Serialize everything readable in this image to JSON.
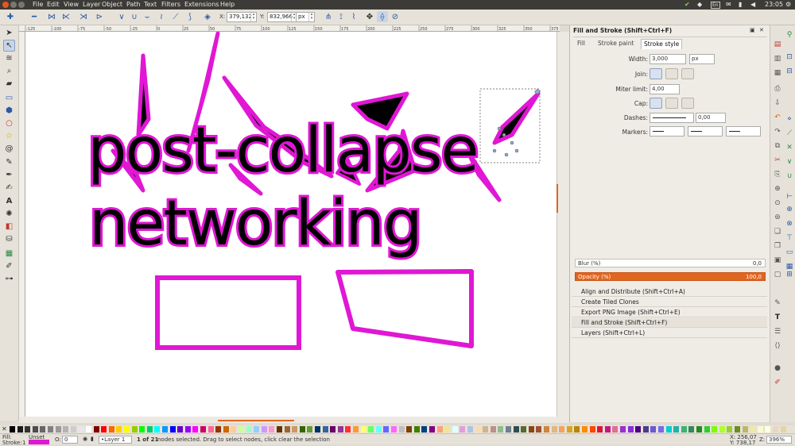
{
  "menubar": {
    "items": [
      "File",
      "Edit",
      "View",
      "Layer",
      "Object",
      "Path",
      "Text",
      "Filters",
      "Extensions",
      "Help"
    ],
    "tray": {
      "lang": "En",
      "clock": "23:05"
    }
  },
  "toolcontrols": {
    "x_label": "X:",
    "x_value": "379,132",
    "y_label": "Y:",
    "y_value": "832,966",
    "unit": "px"
  },
  "ruler": {
    "ticks": [
      "-125",
      "-100",
      "-75",
      "-50",
      "-25",
      "0",
      "25",
      "50",
      "75",
      "100",
      "125",
      "150",
      "175",
      "200",
      "225",
      "250",
      "275",
      "300",
      "325",
      "350",
      "375"
    ]
  },
  "canvas": {
    "line1": "post-collapse",
    "line2": "networking",
    "colors": {
      "magenta": "#e017d4",
      "black": "#000000"
    }
  },
  "dock": {
    "title": "Fill and Stroke (Shift+Ctrl+F)",
    "tabs": [
      "Fill",
      "Stroke paint",
      "Stroke style"
    ],
    "width_label": "Width:",
    "width_value": "3,000",
    "width_unit": "px",
    "join_label": "Join:",
    "miter_label": "Miter limit:",
    "miter_value": "4,00",
    "cap_label": "Cap:",
    "dashes_label": "Dashes:",
    "dashes_value": "0,00",
    "markers_label": "Markers:",
    "blur_label": "Blur (%)",
    "blur_value": "0,0",
    "opacity_label": "Opacity (%)",
    "opacity_value": "100,0",
    "sections": [
      "Align and Distribute (Shift+Ctrl+A)",
      "Create Tiled Clones",
      "Export PNG Image (Shift+Ctrl+E)",
      "Fill and Stroke (Shift+Ctrl+F)",
      "Layers (Shift+Ctrl+L)"
    ]
  },
  "status": {
    "fill_label": "Fill:",
    "stroke_label": "Stroke:",
    "stroke_value": "1",
    "unset": "Unset",
    "opacity_label": "O:",
    "opacity_value": "0",
    "layer": "•Layer 1",
    "message_bold": "1 of 21",
    "message": " nodes selected. Drag to select nodes, click clear the selection",
    "coord_x": "X: 256,07",
    "coord_y": "Y: 738,17",
    "zoom_label": "Z:",
    "zoom_value": "396%"
  },
  "palette_colors": [
    "#000000",
    "#1a1a1a",
    "#333333",
    "#4d4d4d",
    "#666666",
    "#808080",
    "#999999",
    "#b3b3b3",
    "#cccccc",
    "#e6e6e6",
    "#ffffff",
    "#800000",
    "#ff0000",
    "#ff6600",
    "#ffcc00",
    "#ffff00",
    "#99cc00",
    "#00ff00",
    "#00cc66",
    "#00ffff",
    "#0099ff",
    "#0000ff",
    "#6600cc",
    "#9900ff",
    "#ff00ff",
    "#cc0066",
    "#ff6699",
    "#993300",
    "#cc6600",
    "#ffcc99",
    "#ccff99",
    "#99ffcc",
    "#99ccff",
    "#cc99ff",
    "#ff99cc",
    "#663300",
    "#996633",
    "#cc9966",
    "#336600",
    "#669933",
    "#003366",
    "#336699",
    "#660066",
    "#993399",
    "#ff3333",
    "#ff9933",
    "#ffff66",
    "#66ff66",
    "#66ffff",
    "#6666ff",
    "#ff66ff",
    "#c0c0c0",
    "#804000",
    "#408000",
    "#004080",
    "#800080",
    "#ffa07a",
    "#f0e68c",
    "#e0ffff",
    "#dda0dd",
    "#b0c4de",
    "#f5deb3",
    "#d2b48c",
    "#bc8f8f",
    "#8fbc8f",
    "#708090",
    "#2f4f4f",
    "#556b2f",
    "#8b4513",
    "#a0522d",
    "#cd853f",
    "#deb887",
    "#f4a460",
    "#daa520",
    "#b8860b",
    "#ff8c00",
    "#ff4500",
    "#dc143c",
    "#c71585",
    "#db7093",
    "#9932cc",
    "#8a2be2",
    "#4b0082",
    "#483d8b",
    "#6a5acd",
    "#7b68ee",
    "#00ced1",
    "#20b2aa",
    "#3cb371",
    "#2e8b57",
    "#228b22",
    "#32cd32",
    "#7cfc00",
    "#adff2f",
    "#9acd32",
    "#6b8e23",
    "#bdb76b",
    "#eee8aa",
    "#fafad2",
    "#ffffe0",
    "#e9d7c0",
    "#e2d6a0"
  ]
}
